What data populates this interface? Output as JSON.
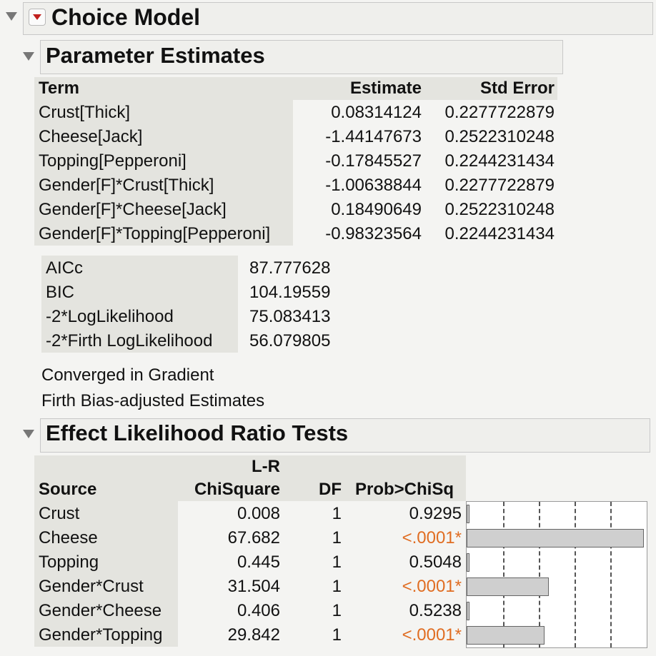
{
  "choice_model": {
    "title": "Choice Model"
  },
  "param_estimates": {
    "title": "Parameter Estimates",
    "headers": {
      "term": "Term",
      "estimate": "Estimate",
      "std_error": "Std Error"
    },
    "rows": [
      {
        "term": "Crust[Thick]",
        "estimate": "0.08314124",
        "std_error": "0.2277722879"
      },
      {
        "term": "Cheese[Jack]",
        "estimate": "-1.44147673",
        "std_error": "0.2522310248"
      },
      {
        "term": "Topping[Pepperoni]",
        "estimate": "-0.17845527",
        "std_error": "0.2244231434"
      },
      {
        "term": "Gender[F]*Crust[Thick]",
        "estimate": "-1.00638844",
        "std_error": "0.2277722879"
      },
      {
        "term": "Gender[F]*Cheese[Jack]",
        "estimate": "0.18490649",
        "std_error": "0.2522310248"
      },
      {
        "term": "Gender[F]*Topping[Pepperoni]",
        "estimate": "-0.98323564",
        "std_error": "0.2244231434"
      }
    ],
    "fit_stats": [
      {
        "label": "AICc",
        "value": "87.777628"
      },
      {
        "label": "BIC",
        "value": "104.19559"
      },
      {
        "label": "-2*LogLikelihood",
        "value": "75.083413"
      },
      {
        "label": "-2*Firth LogLikelihood",
        "value": "56.079805"
      }
    ],
    "notes": [
      "Converged in Gradient",
      "Firth Bias-adjusted Estimates"
    ]
  },
  "effect_tests": {
    "title": "Effect Likelihood Ratio Tests",
    "headers": {
      "source": "Source",
      "lr_top": "L-R",
      "lr_bottom": "ChiSquare",
      "df": "DF",
      "prob": "Prob>ChiSq"
    },
    "rows": [
      {
        "source": "Crust",
        "chisq": "0.008",
        "df": "1",
        "prob": "0.9295",
        "significant": false,
        "bar_value": 0.008
      },
      {
        "source": "Cheese",
        "chisq": "67.682",
        "df": "1",
        "prob": "<.0001*",
        "significant": true,
        "bar_value": 67.682
      },
      {
        "source": "Topping",
        "chisq": "0.445",
        "df": "1",
        "prob": "0.5048",
        "significant": false,
        "bar_value": 0.445
      },
      {
        "source": "Gender*Crust",
        "chisq": "31.504",
        "df": "1",
        "prob": "<.0001*",
        "significant": true,
        "bar_value": 31.504
      },
      {
        "source": "Gender*Cheese",
        "chisq": "0.406",
        "df": "1",
        "prob": "0.5238",
        "significant": false,
        "bar_value": 0.406
      },
      {
        "source": "Gender*Topping",
        "chisq": "29.842",
        "df": "1",
        "prob": "<.0001*",
        "significant": true,
        "bar_value": 29.842
      }
    ]
  },
  "colors": {
    "significant": "#e06d22",
    "bar_fill": "#cfcfcf"
  }
}
